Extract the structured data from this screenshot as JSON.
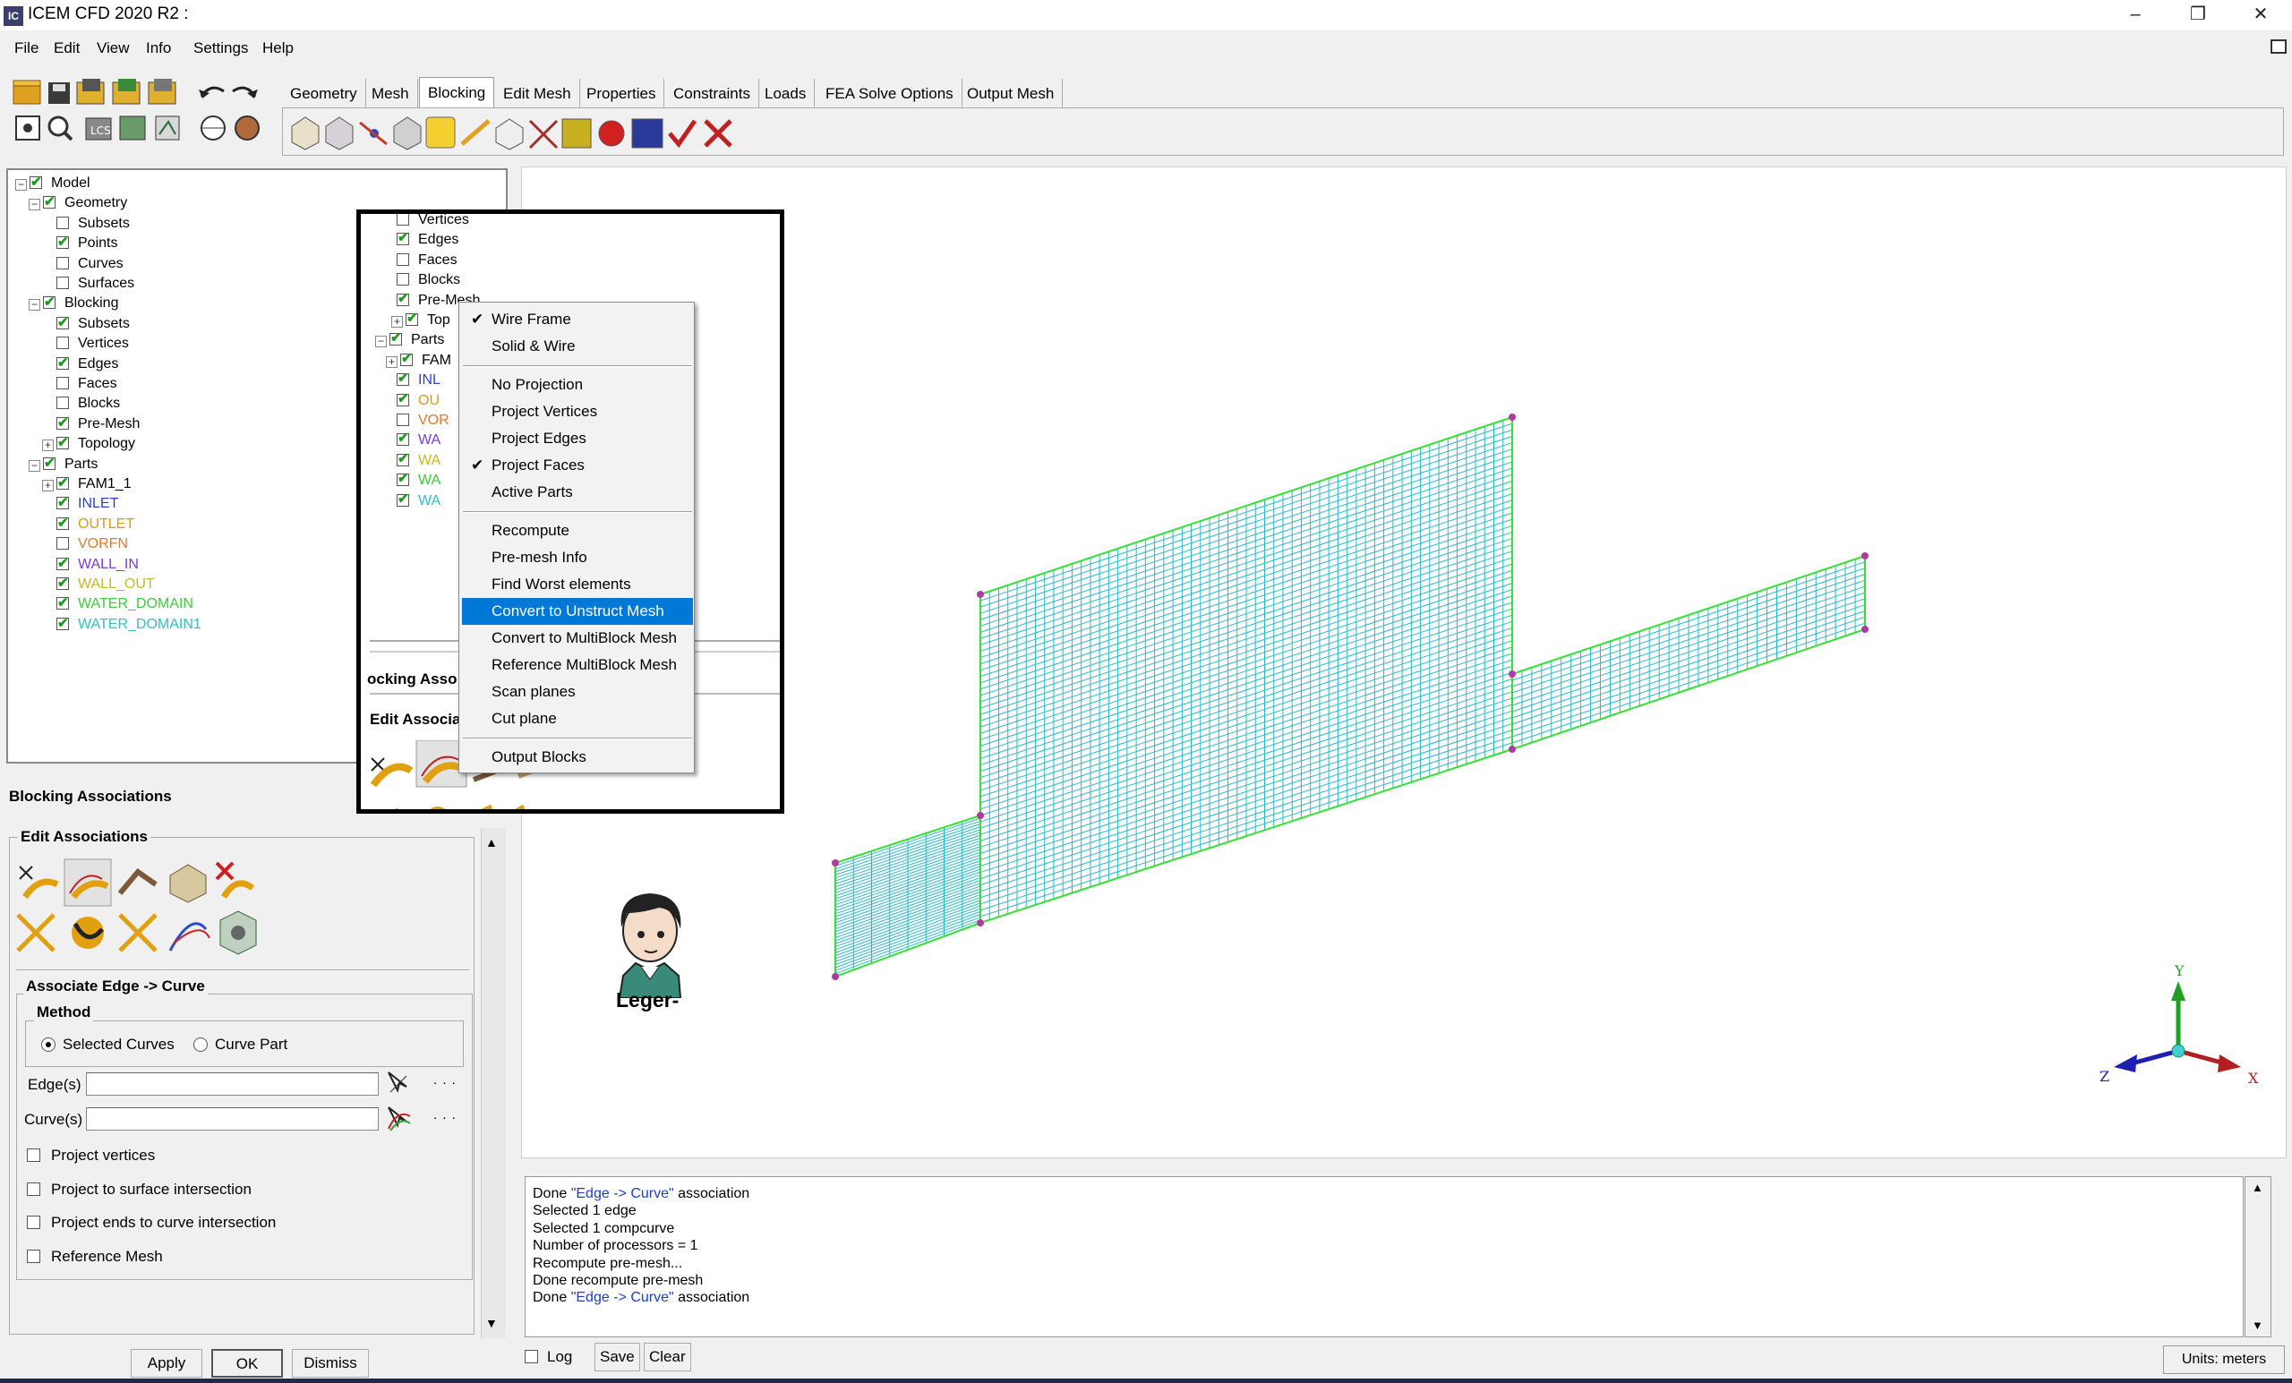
{
  "window": {
    "app_icon_text": "IC",
    "title": "ICEM CFD 2020 R2 :",
    "minimize": "–",
    "maximize": "❐",
    "close": "✕"
  },
  "menu": [
    "File",
    "Edit",
    "View",
    "Info",
    "Settings",
    "Help"
  ],
  "tabs": [
    "Geometry",
    "Mesh",
    "Blocking",
    "Edit Mesh",
    "Properties",
    "Constraints",
    "Loads",
    "FEA Solve Options",
    "Output Mesh"
  ],
  "active_tab": "Blocking",
  "tree": {
    "rows": [
      {
        "label": "Model",
        "level": 0,
        "expander": "-",
        "checked": true,
        "color": "#000000"
      },
      {
        "label": "Geometry",
        "level": 1,
        "expander": "-",
        "checked": true,
        "color": "#000000"
      },
      {
        "label": "Subsets",
        "level": 2,
        "expander": "",
        "checked": false,
        "color": "#000000"
      },
      {
        "label": "Points",
        "level": 2,
        "expander": "",
        "checked": true,
        "color": "#000000"
      },
      {
        "label": "Curves",
        "level": 2,
        "expander": "",
        "checked": false,
        "color": "#000000"
      },
      {
        "label": "Surfaces",
        "level": 2,
        "expander": "",
        "checked": false,
        "color": "#000000"
      },
      {
        "label": "Blocking",
        "level": 1,
        "expander": "-",
        "checked": true,
        "color": "#000000"
      },
      {
        "label": "Subsets",
        "level": 2,
        "expander": "",
        "checked": true,
        "color": "#000000"
      },
      {
        "label": "Vertices",
        "level": 2,
        "expander": "",
        "checked": false,
        "color": "#000000"
      },
      {
        "label": "Edges",
        "level": 2,
        "expander": "",
        "checked": true,
        "color": "#000000"
      },
      {
        "label": "Faces",
        "level": 2,
        "expander": "",
        "checked": false,
        "color": "#000000"
      },
      {
        "label": "Blocks",
        "level": 2,
        "expander": "",
        "checked": false,
        "color": "#000000"
      },
      {
        "label": "Pre-Mesh",
        "level": 2,
        "expander": "",
        "checked": true,
        "color": "#000000"
      },
      {
        "label": "Topology",
        "level": 2,
        "expander": "+",
        "checked": true,
        "color": "#000000"
      },
      {
        "label": "Parts",
        "level": 1,
        "expander": "-",
        "checked": true,
        "color": "#000000"
      },
      {
        "label": "FAM1_1",
        "level": 2,
        "expander": "+",
        "checked": true,
        "color": "#000000"
      },
      {
        "label": "INLET",
        "level": 2,
        "expander": "",
        "checked": true,
        "color": "#2a3fd0"
      },
      {
        "label": "OUTLET",
        "level": 2,
        "expander": "",
        "checked": true,
        "color": "#d99a1a"
      },
      {
        "label": "VORFN",
        "level": 2,
        "expander": "",
        "checked": false,
        "color": "#e0782a"
      },
      {
        "label": "WALL_IN",
        "level": 2,
        "expander": "",
        "checked": true,
        "color": "#7a3bd0"
      },
      {
        "label": "WALL_OUT",
        "level": 2,
        "expander": "",
        "checked": true,
        "color": "#c8b820"
      },
      {
        "label": "WATER_DOMAIN",
        "level": 2,
        "expander": "",
        "checked": true,
        "color": "#3ccc3c"
      },
      {
        "label": "WATER_DOMAIN1",
        "level": 2,
        "expander": "",
        "checked": true,
        "color": "#30c0c8"
      }
    ]
  },
  "inset": {
    "rows": [
      {
        "label": "Vertices",
        "checked": false,
        "expander": "",
        "color": "#000000"
      },
      {
        "label": "Edges",
        "checked": true,
        "expander": "",
        "color": "#000000"
      },
      {
        "label": "Faces",
        "checked": false,
        "expander": "",
        "color": "#000000"
      },
      {
        "label": "Blocks",
        "checked": false,
        "expander": "",
        "color": "#000000"
      },
      {
        "label": "Pre-Mesh",
        "checked": true,
        "expander": "",
        "color": "#000000"
      },
      {
        "label": "Top",
        "checked": true,
        "expander": "+",
        "color": "#000000"
      },
      {
        "label": "Parts",
        "checked": true,
        "expander": "-",
        "color": "#000000"
      },
      {
        "label": "FAM",
        "checked": true,
        "expander": "+",
        "color": "#000000"
      },
      {
        "label": "INL",
        "checked": true,
        "expander": "",
        "color": "#2a3fd0"
      },
      {
        "label": "OU",
        "checked": true,
        "expander": "",
        "color": "#d99a1a"
      },
      {
        "label": "VOR",
        "checked": false,
        "expander": "",
        "color": "#e0782a"
      },
      {
        "label": "WA",
        "checked": true,
        "expander": "",
        "color": "#7a3bd0"
      },
      {
        "label": "WA",
        "checked": true,
        "expander": "",
        "color": "#c8b820"
      },
      {
        "label": "WA",
        "checked": true,
        "expander": "",
        "color": "#3ccc3c"
      },
      {
        "label": "WA",
        "checked": true,
        "expander": "",
        "color": "#30c0c8"
      }
    ],
    "blocking_assoc": "ocking Asso",
    "edit_assoc": "Edit Associa"
  },
  "context_menu": {
    "items": [
      {
        "label": "Wire Frame",
        "checked": true
      },
      {
        "label": "Solid & Wire",
        "checked": false
      },
      {
        "sep": true
      },
      {
        "label": "No Projection",
        "checked": false
      },
      {
        "label": "Project Vertices",
        "checked": false
      },
      {
        "label": "Project Edges",
        "checked": false
      },
      {
        "label": "Project Faces",
        "checked": true
      },
      {
        "label": "Active Parts",
        "checked": false
      },
      {
        "sep": true
      },
      {
        "label": "Recompute",
        "checked": false
      },
      {
        "label": "Pre-mesh Info",
        "checked": false
      },
      {
        "label": "Find Worst elements",
        "checked": false
      },
      {
        "label": "Convert to Unstruct Mesh",
        "checked": false,
        "highlighted": true
      },
      {
        "label": "Convert to MultiBlock Mesh",
        "checked": false
      },
      {
        "label": "Reference MultiBlock Mesh",
        "checked": false
      },
      {
        "label": "Scan planes",
        "checked": false
      },
      {
        "label": "Cut plane",
        "checked": false
      },
      {
        "sep": true
      },
      {
        "label": "Output Blocks",
        "checked": false
      }
    ]
  },
  "assoc": {
    "title": "Blocking Associations",
    "edit_group": "Edit Associations",
    "subpanel": "Associate Edge -> Curve",
    "method_label": "Method",
    "method_options": [
      "Selected Curves",
      "Curve Part"
    ],
    "method_selected": "Selected Curves",
    "edges_label": "Edge(s)",
    "edges_value": "",
    "curves_label": "Curve(s)",
    "curves_value": "",
    "ellipsis": ". . .",
    "checkboxes": [
      "Project vertices",
      "Project to surface intersection",
      "Project ends to curve intersection",
      "Reference Mesh"
    ],
    "buttons": {
      "apply": "Apply",
      "ok": "OK",
      "dismiss": "Dismiss"
    }
  },
  "viewport": {
    "watermark": "Leger-",
    "axes": {
      "x": "X",
      "y": "Y",
      "z": "Z"
    },
    "mesh_color": "#2ab8c8",
    "edge_color": "#35e035"
  },
  "console": {
    "lines": [
      {
        "pre": "Done ",
        "blue": "\"Edge -> Curve\"",
        "post": " association"
      },
      {
        "pre": "Selected 1 edge",
        "blue": "",
        "post": ""
      },
      {
        "pre": "Selected 1 compcurve",
        "blue": "",
        "post": ""
      },
      {
        "pre": "Number of processors = 1",
        "blue": "",
        "post": ""
      },
      {
        "pre": "Recompute pre-mesh...",
        "blue": "",
        "post": ""
      },
      {
        "pre": "Done recompute pre-mesh",
        "blue": "",
        "post": ""
      },
      {
        "pre": "Done ",
        "blue": "\"Edge -> Curve\"",
        "post": " association"
      }
    ],
    "log_label": "Log",
    "save_label": "Save",
    "clear_label": "Clear",
    "units": "Units: meters"
  }
}
